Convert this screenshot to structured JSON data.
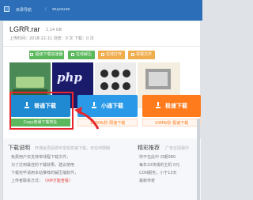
{
  "topbar": {
    "crumb_home": "目录导航",
    "separator": "/",
    "crumb_user": "wuyouxe"
  },
  "file": {
    "name": "LGRR.rar",
    "size": "1.14 GB",
    "meta": "上传时间：2018-12-11   浏览：0 次   下载：0 次"
  },
  "toolbar": {
    "items": [
      {
        "label": "超级下载加速器",
        "color": "#5cb85c"
      },
      {
        "label": "在线解压",
        "color": "#5cb85c"
      },
      {
        "label": "在线打开",
        "color": "#f0ad4e"
      },
      {
        "label": "举报文件",
        "color": "#f0ad4e"
      }
    ]
  },
  "thumbs": {
    "items": [
      {
        "label": "",
        "color": "#3f7a4a"
      },
      {
        "label": "php",
        "color": "#1b1b6b"
      },
      {
        "label": "",
        "color": "#eaeaea"
      },
      {
        "label": "",
        "color": "#f7f3e6"
      }
    ]
  },
  "downloads": {
    "normal": {
      "label": "普通下载",
      "sub": "Copy普通下载地址",
      "color": "#1f8ad2"
    },
    "mini": {
      "label": "小通下载",
      "sub": "180KB/秒 限速下载",
      "color": "#2a9ae8"
    },
    "fast": {
      "label": "极速下载",
      "sub": "10MB/秒 极速下载",
      "color": "#ff7b1c"
    }
  },
  "notes": {
    "title": "下载说明",
    "subtitle": "开通会员后即可享受高速下载，无任何限制",
    "lines": [
      "免费用户仅支持单线程下载文件，",
      "为了达到最佳的下载效果，建议使用",
      "下载完毕请用本站推荐的解压缩软件，",
      "上传者联系方式："
    ],
    "vip_link": "（VIP才能查看）"
  },
  "recommend": {
    "title": "精彩推荐",
    "subtitle": "广告位招租中",
    "lines": [
      "你不在此中 日期380",
      "每年10块钱的主机 0元",
      "CDN服务，小于13天",
      "最新传奇"
    ]
  }
}
